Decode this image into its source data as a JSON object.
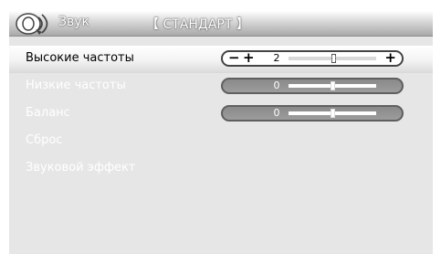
{
  "header": {
    "title": "Звук",
    "mode": "【 СТАНДАРТ 】"
  },
  "menu": {
    "items": [
      {
        "label": "Высокие частоты",
        "value": "2",
        "level": 0.52,
        "selected": true
      },
      {
        "label": "Низкие частоты",
        "value": "0",
        "level": 0.5,
        "selected": false
      },
      {
        "label": "Баланс",
        "value": "0",
        "level": 0.5,
        "selected": false
      },
      {
        "label": "Сброс"
      },
      {
        "label": "Звуковой эффект"
      }
    ]
  },
  "controls": {
    "minus_symbol": "−",
    "plus_symbol": "+"
  },
  "colors": {
    "panel": "#e6e6e6",
    "selected_text": "#000000",
    "unselected_text": "#ffffff",
    "inactive_slider": "#8a8a8a"
  }
}
